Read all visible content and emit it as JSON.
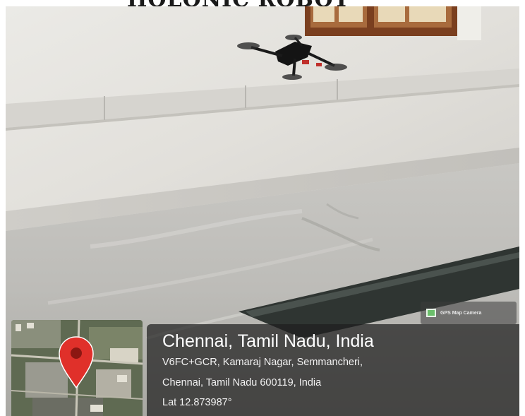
{
  "header": {
    "title": "HOLONIC ROBOT"
  },
  "photo": {
    "subject": "quadcopter-drone"
  },
  "gps_overlay": {
    "badge_label": "GPS Map Camera",
    "place": "Chennai, Tamil Nadu, India",
    "address_line1": "V6FC+GCR, Kamaraj Nagar, Semmancheri,",
    "address_line2": "Chennai, Tamil Nadu 600119, India",
    "latitude": "Lat 12.873987°",
    "pin_color": "#e0302a"
  }
}
